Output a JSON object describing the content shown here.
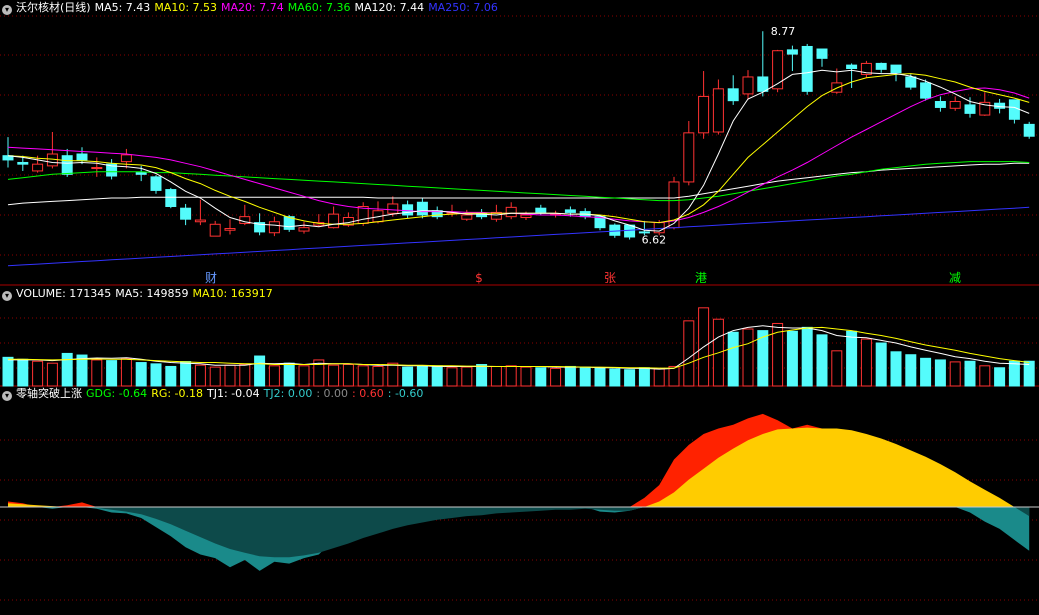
{
  "panel_headers": {
    "main": [
      {
        "text": "沃尔核材(日线)",
        "color": "#ffffff"
      },
      {
        "text": "MA5: 7.43",
        "color": "#ffffff"
      },
      {
        "text": "MA10: 7.53",
        "color": "#ffff00"
      },
      {
        "text": "MA20: 7.74",
        "color": "#ff00ff"
      },
      {
        "text": "MA60: 7.36",
        "color": "#00ff00"
      },
      {
        "text": "MA120: 7.44",
        "color": "#ffffff"
      },
      {
        "text": "MA250: 7.06",
        "color": "#3333ff"
      }
    ],
    "volume": [
      {
        "text": "VOLUME: 171345",
        "color": "#ffffff"
      },
      {
        "text": "MA5: 149859",
        "color": "#ffffff"
      },
      {
        "text": "MA10: 163917",
        "color": "#ffff00"
      }
    ],
    "indicator": [
      {
        "text": "零轴突破上涨",
        "color": "#ffffff"
      },
      {
        "text": "GDG: -0.64",
        "color": "#00ff00"
      },
      {
        "text": "RG: -0.18",
        "color": "#ffff00"
      },
      {
        "text": "TJ1: -0.04",
        "color": "#ffffff"
      },
      {
        "text": "TJ2: 0.00",
        "color": "#33cccc"
      },
      {
        "text": ": 0.00",
        "color": "#888888"
      },
      {
        "text": ": 0.60",
        "color": "#ff3333"
      },
      {
        "text": ": -0.60",
        "color": "#33cccc"
      }
    ]
  },
  "colors": {
    "up": "#ff3232",
    "down": "#54fcfc",
    "grid": "#8b0000",
    "ma5": "#ffffff",
    "ma10": "#ffff00",
    "ma20": "#ff00ff",
    "ma60": "#00ff00",
    "ma120": "#ffffff",
    "ma250": "#3333ff",
    "ind_red": "#ff2200",
    "ind_yellow": "#ffcc00",
    "ind_teal": "#1a8a8a",
    "ind_dark": "#0d4a4a"
  },
  "chart_data": [
    {
      "type": "candlestick",
      "x": [
        1,
        2,
        3,
        4,
        5,
        6,
        7,
        8,
        9,
        10,
        11,
        12,
        13,
        14,
        15,
        16,
        17,
        18,
        19,
        20,
        21,
        22,
        23,
        24,
        25,
        26,
        27,
        28,
        29,
        30,
        31,
        32,
        33,
        34,
        35,
        36,
        37,
        38,
        39,
        40,
        41,
        42,
        43,
        44,
        45,
        46,
        47,
        48,
        49,
        50,
        51,
        52,
        53,
        54,
        55,
        56,
        57,
        58,
        59,
        60,
        61,
        62,
        63,
        64,
        65,
        66,
        67,
        68,
        69,
        70
      ],
      "open": [
        7.3,
        7.22,
        7.12,
        7.18,
        7.3,
        7.32,
        7.15,
        7.2,
        7.23,
        7.1,
        7.05,
        6.9,
        6.68,
        6.52,
        6.35,
        6.42,
        6.5,
        6.51,
        6.39,
        6.58,
        6.41,
        6.48,
        6.45,
        6.48,
        6.5,
        6.52,
        6.62,
        6.72,
        6.75,
        6.65,
        6.62,
        6.55,
        6.62,
        6.55,
        6.58,
        6.57,
        6.68,
        6.6,
        6.66,
        6.64,
        6.58,
        6.48,
        6.48,
        6.4,
        6.39,
        6.45,
        6.99,
        7.57,
        7.58,
        8.09,
        8.03,
        8.23,
        8.09,
        8.55,
        8.59,
        8.56,
        8.05,
        8.37,
        8.26,
        8.39,
        8.37,
        8.23,
        8.16,
        7.94,
        7.86,
        7.9,
        7.78,
        7.92,
        7.96,
        7.67
      ],
      "close": [
        7.25,
        7.2,
        7.2,
        7.32,
        7.08,
        7.25,
        7.16,
        7.06,
        7.31,
        7.08,
        6.89,
        6.7,
        6.55,
        6.54,
        6.49,
        6.44,
        6.58,
        6.4,
        6.52,
        6.43,
        6.45,
        6.51,
        6.61,
        6.57,
        6.7,
        6.65,
        6.73,
        6.6,
        6.6,
        6.58,
        6.63,
        6.6,
        6.58,
        6.63,
        6.69,
        6.6,
        6.63,
        6.61,
        6.63,
        6.58,
        6.45,
        6.36,
        6.34,
        6.39,
        6.51,
        6.99,
        7.57,
        8.0,
        8.09,
        7.95,
        8.23,
        8.06,
        8.54,
        8.5,
        8.06,
        8.45,
        8.16,
        8.33,
        8.39,
        8.32,
        8.28,
        8.11,
        7.98,
        7.87,
        7.94,
        7.8,
        7.93,
        7.86,
        7.73,
        7.53
      ],
      "high": [
        7.52,
        7.3,
        7.3,
        7.58,
        7.38,
        7.4,
        7.28,
        7.26,
        7.38,
        7.18,
        7.07,
        6.92,
        6.73,
        6.78,
        6.53,
        6.55,
        6.72,
        6.62,
        6.58,
        6.6,
        6.52,
        6.61,
        6.7,
        6.63,
        6.75,
        6.76,
        6.82,
        6.77,
        6.8,
        6.7,
        6.72,
        6.66,
        6.67,
        6.72,
        6.75,
        6.64,
        6.72,
        6.65,
        6.7,
        6.68,
        6.6,
        6.5,
        6.38,
        6.53,
        6.54,
        7.05,
        7.71,
        8.3,
        8.2,
        8.25,
        8.31,
        8.77,
        8.55,
        8.6,
        8.62,
        8.46,
        8.33,
        8.39,
        8.42,
        8.4,
        8.3,
        8.26,
        8.2,
        8.0,
        8.0,
        7.99,
        8.05,
        7.97,
        7.86,
        7.7
      ],
      "low": [
        7.16,
        7.12,
        7.1,
        7.15,
        7.05,
        7.2,
        7.05,
        7.02,
        7.15,
        7.0,
        6.85,
        6.68,
        6.48,
        6.48,
        6.36,
        6.37,
        6.48,
        6.36,
        6.35,
        6.4,
        6.38,
        6.46,
        6.44,
        6.46,
        6.47,
        6.5,
        6.58,
        6.56,
        6.56,
        6.55,
        6.58,
        6.53,
        6.55,
        6.52,
        6.55,
        6.54,
        6.6,
        6.57,
        6.58,
        6.55,
        6.42,
        6.33,
        6.31,
        6.36,
        6.36,
        6.43,
        6.95,
        7.5,
        7.55,
        7.9,
        7.96,
        8.0,
        8.05,
        8.3,
        8.02,
        8.35,
        8.03,
        8.1,
        8.22,
        8.28,
        8.18,
        8.08,
        7.95,
        7.82,
        7.83,
        7.75,
        7.77,
        7.8,
        7.68,
        7.5
      ],
      "volume": [
        88000,
        82000,
        76000,
        70000,
        100000,
        95000,
        80000,
        78000,
        84000,
        72000,
        68000,
        60000,
        75000,
        64000,
        58000,
        64000,
        66000,
        92000,
        62000,
        70000,
        62000,
        80000,
        64000,
        66000,
        62000,
        60000,
        70000,
        58000,
        60000,
        62000,
        56000,
        58000,
        66000,
        60000,
        62000,
        58000,
        56000,
        54000,
        60000,
        58000,
        56000,
        52000,
        50000,
        56000,
        52000,
        60000,
        200000,
        240000,
        205000,
        165000,
        175000,
        170000,
        192000,
        168000,
        180000,
        157000,
        108000,
        168000,
        144000,
        132000,
        105000,
        96000,
        85000,
        80000,
        74000,
        76000,
        62000,
        56000,
        76000,
        76000
      ],
      "ma5": [
        7.3,
        7.28,
        7.25,
        7.22,
        7.21,
        7.22,
        7.21,
        7.18,
        7.17,
        7.15,
        7.09,
        6.99,
        6.88,
        6.8,
        6.68,
        6.57,
        6.52,
        6.49,
        6.48,
        6.46,
        6.48,
        6.46,
        6.49,
        6.51,
        6.55,
        6.58,
        6.61,
        6.63,
        6.65,
        6.65,
        6.63,
        6.61,
        6.61,
        6.6,
        6.62,
        6.62,
        6.62,
        6.62,
        6.61,
        6.61,
        6.59,
        6.53,
        6.48,
        6.42,
        6.41,
        6.5,
        6.68,
        6.95,
        7.32,
        7.71,
        7.97,
        8.05,
        8.15,
        8.26,
        8.28,
        8.31,
        8.29,
        8.31,
        8.28,
        8.27,
        8.27,
        8.24,
        8.18,
        8.11,
        8.03,
        7.94,
        7.9,
        7.88,
        7.87,
        7.8
      ],
      "ma10": [
        7.3,
        7.29,
        7.27,
        7.26,
        7.24,
        7.24,
        7.23,
        7.21,
        7.2,
        7.19,
        7.16,
        7.1,
        7.03,
        6.97,
        6.89,
        6.82,
        6.76,
        6.69,
        6.63,
        6.57,
        6.53,
        6.5,
        6.49,
        6.49,
        6.5,
        6.52,
        6.54,
        6.56,
        6.58,
        6.6,
        6.61,
        6.62,
        6.62,
        6.62,
        6.62,
        6.62,
        6.62,
        6.62,
        6.61,
        6.61,
        6.6,
        6.58,
        6.55,
        6.52,
        6.51,
        6.54,
        6.61,
        6.72,
        6.88,
        7.08,
        7.28,
        7.43,
        7.58,
        7.73,
        7.88,
        8.01,
        8.1,
        8.17,
        8.22,
        8.24,
        8.26,
        8.27,
        8.25,
        8.21,
        8.17,
        8.11,
        8.06,
        8.02,
        7.98,
        7.93
      ],
      "ma20": [
        7.4,
        7.39,
        7.38,
        7.37,
        7.36,
        7.35,
        7.34,
        7.33,
        7.32,
        7.3,
        7.28,
        7.25,
        7.21,
        7.17,
        7.12,
        7.07,
        7.02,
        6.97,
        6.92,
        6.87,
        6.82,
        6.77,
        6.73,
        6.7,
        6.68,
        6.67,
        6.66,
        6.65,
        6.64,
        6.64,
        6.64,
        6.63,
        6.63,
        6.62,
        6.62,
        6.61,
        6.6,
        6.6,
        6.59,
        6.58,
        6.57,
        6.55,
        6.53,
        6.52,
        6.51,
        6.53,
        6.57,
        6.63,
        6.7,
        6.78,
        6.87,
        6.96,
        7.05,
        7.13,
        7.22,
        7.32,
        7.42,
        7.52,
        7.61,
        7.7,
        7.79,
        7.88,
        7.96,
        8.02,
        8.06,
        8.09,
        8.1,
        8.08,
        8.04,
        7.98
      ],
      "ma60": [
        7.02,
        7.04,
        7.06,
        7.08,
        7.09,
        7.1,
        7.11,
        7.11,
        7.11,
        7.11,
        7.1,
        7.1,
        7.09,
        7.08,
        7.07,
        7.06,
        7.05,
        7.04,
        7.03,
        7.02,
        7.01,
        7.0,
        6.99,
        6.98,
        6.97,
        6.96,
        6.95,
        6.94,
        6.93,
        6.92,
        6.91,
        6.9,
        6.89,
        6.88,
        6.87,
        6.86,
        6.85,
        6.84,
        6.83,
        6.82,
        6.81,
        6.8,
        6.79,
        6.78,
        6.77,
        6.77,
        6.78,
        6.8,
        6.82,
        6.85,
        6.88,
        6.91,
        6.94,
        6.97,
        7.0,
        7.03,
        7.06,
        7.08,
        7.11,
        7.14,
        7.16,
        7.18,
        7.2,
        7.21,
        7.22,
        7.23,
        7.23,
        7.23,
        7.23,
        7.22
      ],
      "ma120": [
        6.72,
        6.74,
        6.75,
        6.76,
        6.77,
        6.78,
        6.79,
        6.8,
        6.8,
        6.81,
        6.81,
        6.81,
        6.81,
        6.81,
        6.81,
        6.81,
        6.81,
        6.81,
        6.81,
        6.81,
        6.81,
        6.81,
        6.81,
        6.81,
        6.81,
        6.8,
        6.8,
        6.8,
        6.8,
        6.8,
        6.8,
        6.8,
        6.8,
        6.8,
        6.8,
        6.8,
        6.8,
        6.8,
        6.8,
        6.8,
        6.8,
        6.8,
        6.8,
        6.8,
        6.8,
        6.8,
        6.82,
        6.85,
        6.88,
        6.91,
        6.94,
        6.97,
        7.0,
        7.02,
        7.04,
        7.06,
        7.08,
        7.1,
        7.11,
        7.13,
        7.14,
        7.15,
        7.16,
        7.17,
        7.18,
        7.19,
        7.2,
        7.2,
        7.21,
        7.21
      ],
      "ma250": [
        6.0,
        6.01,
        6.02,
        6.03,
        6.04,
        6.05,
        6.06,
        6.07,
        6.08,
        6.09,
        6.1,
        6.11,
        6.12,
        6.13,
        6.14,
        6.15,
        6.16,
        6.17,
        6.18,
        6.19,
        6.2,
        6.21,
        6.22,
        6.23,
        6.24,
        6.25,
        6.26,
        6.27,
        6.28,
        6.29,
        6.3,
        6.31,
        6.32,
        6.33,
        6.34,
        6.35,
        6.36,
        6.37,
        6.38,
        6.39,
        6.4,
        6.41,
        6.42,
        6.43,
        6.44,
        6.45,
        6.46,
        6.47,
        6.48,
        6.49,
        6.5,
        6.51,
        6.52,
        6.53,
        6.54,
        6.55,
        6.56,
        6.57,
        6.58,
        6.59,
        6.6,
        6.61,
        6.62,
        6.63,
        6.64,
        6.65,
        6.66,
        6.67,
        6.68,
        6.69
      ],
      "vol_ma5": [
        80000,
        80000,
        80000,
        78000,
        81000,
        84000,
        86000,
        85000,
        87000,
        82000,
        76000,
        72000,
        70000,
        68000,
        64000,
        64000,
        64000,
        70000,
        68000,
        70000,
        66000,
        70000,
        68000,
        68000,
        66000,
        64000,
        64000,
        62000,
        62000,
        60000,
        60000,
        60000,
        60000,
        60000,
        60000,
        60000,
        60000,
        58000,
        58000,
        58000,
        56000,
        56000,
        54000,
        54000,
        52000,
        54000,
        86000,
        120000,
        150000,
        170000,
        180000,
        185000,
        180000,
        178000,
        178000,
        170000,
        155000,
        150000,
        148000,
        140000,
        132000,
        120000,
        110000,
        100000,
        90000,
        84000,
        76000,
        70000,
        68000,
        66000
      ],
      "vol_ma10": [
        82000,
        82000,
        81000,
        80000,
        81000,
        82000,
        83000,
        82000,
        82000,
        80000,
        78000,
        76000,
        74000,
        72000,
        72000,
        70000,
        68000,
        68000,
        66000,
        66000,
        66000,
        66000,
        68000,
        68000,
        66000,
        66000,
        65000,
        64000,
        64000,
        62000,
        62000,
        61000,
        61000,
        60000,
        60000,
        60000,
        60000,
        60000,
        59000,
        58000,
        58000,
        57000,
        56000,
        56000,
        55000,
        55000,
        70000,
        88000,
        102000,
        118000,
        130000,
        150000,
        165000,
        172000,
        178000,
        180000,
        175000,
        170000,
        162000,
        155000,
        146000,
        136000,
        126000,
        118000,
        110000,
        100000,
        92000,
        84000,
        78000,
        72000
      ],
      "price_labels": {
        "low": "6.62",
        "high": "8.77"
      },
      "event_markers": [
        {
          "idx": 16,
          "text": "财",
          "color": "#6699ff"
        },
        {
          "idx": 40,
          "text": "$",
          "color": "#ff3333"
        },
        {
          "idx": 51,
          "text": "张",
          "color": "#ff3333"
        },
        {
          "idx": 58,
          "text": "港",
          "color": "#00ff00"
        },
        {
          "idx": 79,
          "text": "减",
          "color": "#00ff00"
        }
      ]
    },
    {
      "type": "area",
      "title": "零轴突破上涨",
      "x": [
        1,
        2,
        3,
        4,
        5,
        6,
        7,
        8,
        9,
        10,
        11,
        12,
        13,
        14,
        15,
        16,
        17,
        18,
        19,
        20,
        21,
        22,
        23,
        24,
        25,
        26,
        27,
        28,
        29,
        30,
        31,
        32,
        33,
        34,
        35,
        36,
        37,
        38,
        39,
        40,
        41,
        42,
        43,
        44,
        45,
        46,
        47,
        48,
        49,
        50,
        51,
        52,
        53,
        54,
        55,
        56,
        57,
        58,
        59,
        60,
        61,
        62,
        63,
        64,
        65,
        66,
        67,
        68,
        69,
        70
      ],
      "fast": [
        0.06,
        0.04,
        0.0,
        -0.02,
        0.02,
        0.05,
        -0.02,
        -0.06,
        -0.07,
        -0.12,
        -0.22,
        -0.32,
        -0.44,
        -0.52,
        -0.56,
        -0.66,
        -0.58,
        -0.7,
        -0.6,
        -0.62,
        -0.56,
        -0.52,
        -0.36,
        -0.3,
        -0.22,
        -0.16,
        -0.14,
        -0.12,
        -0.15,
        -0.12,
        -0.1,
        -0.08,
        -0.07,
        -0.06,
        -0.05,
        -0.04,
        -0.03,
        -0.02,
        -0.01,
        0.0,
        -0.05,
        -0.06,
        -0.04,
        0.1,
        0.24,
        0.52,
        0.68,
        0.8,
        0.86,
        0.9,
        0.97,
        1.02,
        0.95,
        0.86,
        0.9,
        0.86,
        0.85,
        0.8,
        0.7,
        0.62,
        0.52,
        0.4,
        0.3,
        0.2,
        0.08,
        -0.06,
        -0.16,
        -0.24,
        -0.36,
        -0.48
      ],
      "slow": [
        0.04,
        0.03,
        0.02,
        0.01,
        0.0,
        0.0,
        -0.01,
        -0.03,
        -0.05,
        -0.08,
        -0.13,
        -0.19,
        -0.26,
        -0.33,
        -0.4,
        -0.46,
        -0.5,
        -0.54,
        -0.55,
        -0.55,
        -0.53,
        -0.5,
        -0.45,
        -0.4,
        -0.34,
        -0.29,
        -0.24,
        -0.2,
        -0.17,
        -0.14,
        -0.12,
        -0.1,
        -0.09,
        -0.07,
        -0.06,
        -0.05,
        -0.04,
        -0.03,
        -0.03,
        -0.02,
        -0.03,
        -0.04,
        -0.04,
        0.0,
        0.06,
        0.16,
        0.3,
        0.42,
        0.54,
        0.64,
        0.73,
        0.8,
        0.85,
        0.86,
        0.87,
        0.86,
        0.86,
        0.84,
        0.8,
        0.75,
        0.69,
        0.62,
        0.55,
        0.47,
        0.38,
        0.28,
        0.19,
        0.1,
        0.0,
        -0.1
      ],
      "zero_line": 0
    }
  ]
}
